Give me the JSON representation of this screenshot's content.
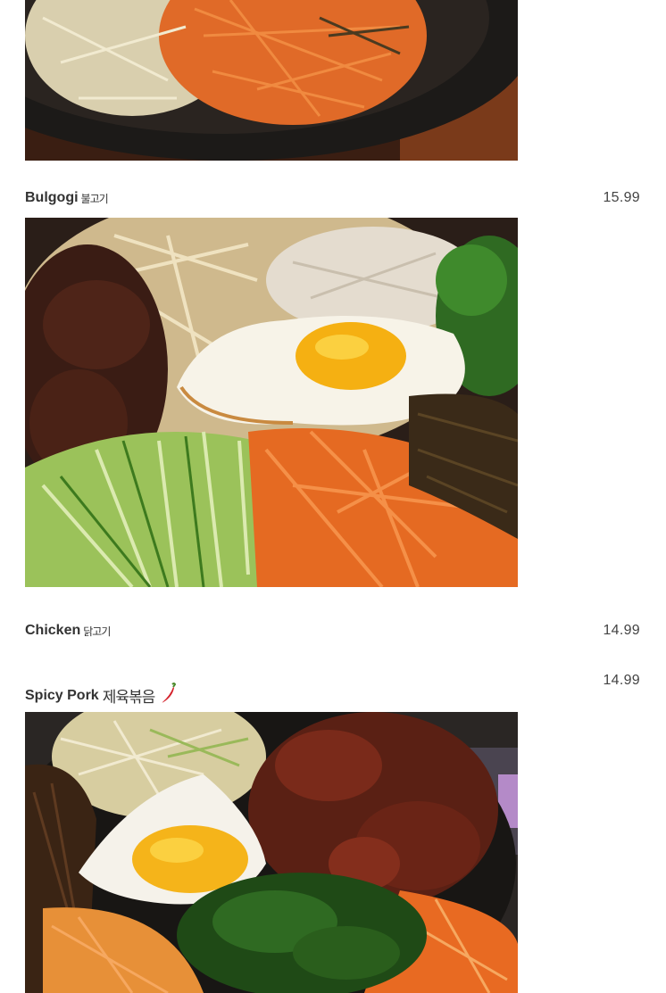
{
  "menu": {
    "items": [
      {
        "name": "Bulgogi",
        "korean": "불고기",
        "price": "15.99",
        "spicy": false,
        "image": "bulgogi-bibimbap-photo"
      },
      {
        "name": "Chicken",
        "korean": "닭고기",
        "price": "14.99",
        "spicy": false
      },
      {
        "name": "Spicy Pork",
        "korean": "제육볶음",
        "price": "14.99",
        "spicy": true,
        "spicy_icon": "chili-pepper-icon",
        "image": "spicy-pork-bibimbap-photo"
      }
    ]
  },
  "colors": {
    "text": "#333333",
    "price": "#444444",
    "pepper": "#d4202a"
  }
}
